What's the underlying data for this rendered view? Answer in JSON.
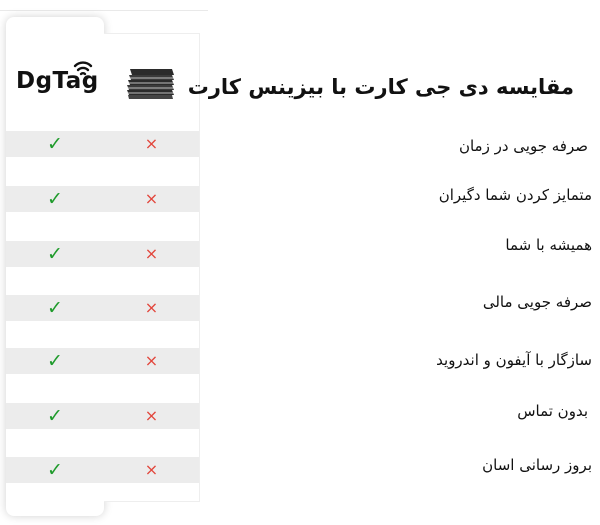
{
  "header": {
    "title": "مقایسه دی جی کارت با بیزینس کارت"
  },
  "columns": {
    "dgtag": {
      "logo_text": "DgTag"
    },
    "business_card": {
      "icon": "card-stack-icon"
    }
  },
  "rows": [
    {
      "feature": "صرفه جویی در زمان",
      "dgtag": "✓",
      "business_card": "×"
    },
    {
      "feature": "متمایز کردن شما دگیران",
      "dgtag": "✓",
      "business_card": "×"
    },
    {
      "feature": "همیشه با شما",
      "dgtag": "✓",
      "business_card": "×"
    },
    {
      "feature": "صرفه جویی مالی",
      "dgtag": "✓",
      "business_card": "×"
    },
    {
      "feature": "سازگار با آیفون و اندروید",
      "dgtag": "✓",
      "business_card": "×"
    },
    {
      "feature": "بدون تماس",
      "dgtag": "✓",
      "business_card": "×"
    },
    {
      "feature": "بروز رسانی اسان",
      "dgtag": "✓",
      "business_card": "×"
    }
  ],
  "colors": {
    "check": "#1f9b2c",
    "cross": "#e2463c",
    "row_shade": "#ececec"
  }
}
